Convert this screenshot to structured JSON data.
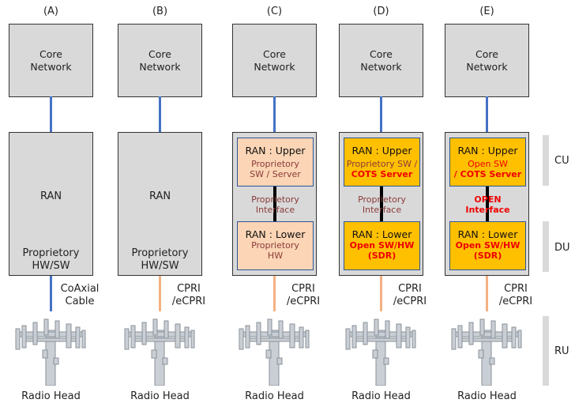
{
  "columns": [
    {
      "label": "(A)",
      "core": "Core\nNetwork",
      "ran_type": "mono",
      "ran_title": "RAN",
      "ran_sub": "Proprietory\nHW/SW",
      "link": "CoAxial\nCable",
      "link_color": "#4472c4",
      "radio": "Radio Head"
    },
    {
      "label": "(B)",
      "core": "Core\nNetwork",
      "ran_type": "mono",
      "ran_title": "RAN",
      "ran_sub": "Proprietory\nHW/SW",
      "link": "CPRI\n/eCPRI",
      "link_color": "#f4b183",
      "radio": "Radio Head"
    },
    {
      "label": "(C)",
      "core": "Core\nNetwork",
      "ran_type": "split",
      "fill": "#fbd5b5",
      "upper": "RAN : Upper",
      "upper_sub": "Proprietory\nSW / Server",
      "upper_bold": "",
      "iface": "Proprietory\nInterface",
      "iface_open": false,
      "lower": "RAN : Lower",
      "lower_sub": "Proprietory\nHW",
      "lower_open": false,
      "link": "CPRI\n/eCPRI",
      "link_color": "#f4b183",
      "radio": "Radio Head"
    },
    {
      "label": "(D)",
      "core": "Core\nNetwork",
      "ran_type": "split",
      "fill": "#ffc000",
      "upper": "RAN : Upper",
      "upper_sub": "Proprietory SW /",
      "upper_bold": "COTS Server",
      "iface": "Proprietory\nInterface",
      "iface_open": false,
      "lower": "RAN : Lower",
      "lower_sub": "Open SW/HW\n(SDR)",
      "lower_open": true,
      "link": "CPRI\n/eCPRI",
      "link_color": "#f4b183",
      "radio": "Radio Head"
    },
    {
      "label": "(E)",
      "core": "Core\nNetwork",
      "ran_type": "split",
      "fill": "#ffc000",
      "upper": "RAN : Upper",
      "upper_sub": "Open SW",
      "upper_bold": "/ COTS Server",
      "upper_sub_red": true,
      "iface": "OPEN\nInterface",
      "iface_open": true,
      "lower": "RAN : Lower",
      "lower_sub": "Open SW/HW\n(SDR)",
      "lower_open": true,
      "link": "CPRI\n/eCPRI",
      "link_color": "#f4b183",
      "radio": "Radio Head"
    }
  ],
  "tiers": {
    "cu": "CU",
    "du": "DU",
    "ru": "RU"
  },
  "colors": {
    "box": "#d9d9d9",
    "core_link": "#4472c4",
    "open_text": "#ff0000",
    "prop_text": "#8b3a3a"
  }
}
